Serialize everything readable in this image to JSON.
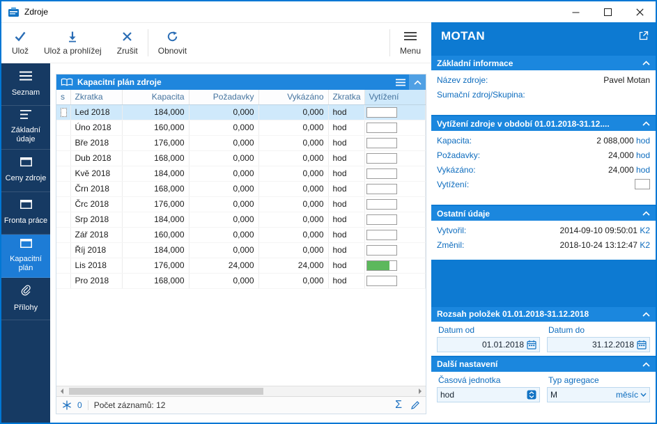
{
  "window": {
    "title": "Zdroje"
  },
  "colors": {
    "accent": "#0d7ad2",
    "sidebar": "#163a63",
    "selection": "#cfe9fb",
    "utilization_green": "#5cb85c",
    "label_blue": "#0d6cbe"
  },
  "icons": {
    "sigma": "Σ"
  },
  "toolbar": {
    "save": "Ulož",
    "save_and_view": "Ulož a prohlížej",
    "cancel": "Zrušit",
    "refresh": "Obnovit",
    "menu": "Menu"
  },
  "sidebar": {
    "items": [
      {
        "id": "seznam",
        "label": "Seznam",
        "icon": "menu",
        "selected": false
      },
      {
        "id": "zakladni-udaje",
        "label": "Základní údaje",
        "icon": "list",
        "selected": false
      },
      {
        "id": "ceny-zdroje",
        "label": "Ceny zdroje",
        "icon": "panel",
        "selected": false
      },
      {
        "id": "fronta-prace",
        "label": "Fronta práce",
        "icon": "panel",
        "selected": false
      },
      {
        "id": "kapacitni-plan",
        "label": "Kapacitní plán",
        "icon": "panel",
        "selected": true
      },
      {
        "id": "prilohy",
        "label": "Přílohy",
        "icon": "clip",
        "selected": false
      }
    ]
  },
  "grid": {
    "title": "Kapacitní plán zdroje",
    "columns": [
      "s",
      "Zkratka",
      "Kapacita",
      "Požadavky",
      "Vykázáno",
      "Zkratka",
      "Vytížení"
    ],
    "rows": [
      {
        "zkratka": "Led 2018",
        "kapacita": "184,000",
        "pozadavky": "0,000",
        "vykazano": "0,000",
        "jednotka": "hod",
        "vytizeni_pct": 0,
        "selected": true
      },
      {
        "zkratka": "Úno 2018",
        "kapacita": "160,000",
        "pozadavky": "0,000",
        "vykazano": "0,000",
        "jednotka": "hod",
        "vytizeni_pct": 0,
        "selected": false
      },
      {
        "zkratka": "Bře 2018",
        "kapacita": "176,000",
        "pozadavky": "0,000",
        "vykazano": "0,000",
        "jednotka": "hod",
        "vytizeni_pct": 0,
        "selected": false
      },
      {
        "zkratka": "Dub 2018",
        "kapacita": "168,000",
        "pozadavky": "0,000",
        "vykazano": "0,000",
        "jednotka": "hod",
        "vytizeni_pct": 0,
        "selected": false
      },
      {
        "zkratka": "Kvě 2018",
        "kapacita": "184,000",
        "pozadavky": "0,000",
        "vykazano": "0,000",
        "jednotka": "hod",
        "vytizeni_pct": 0,
        "selected": false
      },
      {
        "zkratka": "Črn 2018",
        "kapacita": "168,000",
        "pozadavky": "0,000",
        "vykazano": "0,000",
        "jednotka": "hod",
        "vytizeni_pct": 0,
        "selected": false
      },
      {
        "zkratka": "Črc 2018",
        "kapacita": "176,000",
        "pozadavky": "0,000",
        "vykazano": "0,000",
        "jednotka": "hod",
        "vytizeni_pct": 0,
        "selected": false
      },
      {
        "zkratka": "Srp 2018",
        "kapacita": "184,000",
        "pozadavky": "0,000",
        "vykazano": "0,000",
        "jednotka": "hod",
        "vytizeni_pct": 0,
        "selected": false
      },
      {
        "zkratka": "Zář 2018",
        "kapacita": "160,000",
        "pozadavky": "0,000",
        "vykazano": "0,000",
        "jednotka": "hod",
        "vytizeni_pct": 0,
        "selected": false
      },
      {
        "zkratka": "Říj 2018",
        "kapacita": "184,000",
        "pozadavky": "0,000",
        "vykazano": "0,000",
        "jednotka": "hod",
        "vytizeni_pct": 0,
        "selected": false
      },
      {
        "zkratka": "Lis 2018",
        "kapacita": "176,000",
        "pozadavky": "24,000",
        "vykazano": "24,000",
        "jednotka": "hod",
        "vytizeni_pct": 78,
        "selected": false
      },
      {
        "zkratka": "Pro 2018",
        "kapacita": "168,000",
        "pozadavky": "0,000",
        "vykazano": "0,000",
        "jednotka": "hod",
        "vytizeni_pct": 0,
        "selected": false
      }
    ],
    "status": {
      "flag_count": "0",
      "record_count_text": "Počet záznamů: 12"
    }
  },
  "detail": {
    "title": "MOTAN",
    "basic": {
      "header": "Základní informace",
      "fields": [
        {
          "label": "Název zdroje:",
          "value": "Pavel Motan"
        },
        {
          "label": "Sumační zdroj/Skupina:",
          "value": ""
        }
      ]
    },
    "utilization": {
      "header": "Vytížení zdroje v období 01.01.2018-31.12....",
      "fields": [
        {
          "label": "Kapacita:",
          "value": "2 088,000",
          "unit": "hod"
        },
        {
          "label": "Požadavky:",
          "value": "24,000",
          "unit": "hod"
        },
        {
          "label": "Vykázáno:",
          "value": "24,000",
          "unit": "hod"
        },
        {
          "label": "Vytížení:",
          "box": true
        }
      ]
    },
    "other": {
      "header": "Ostatní údaje",
      "fields": [
        {
          "label": "Vytvořil:",
          "value": "2014-09-10 09:50:01",
          "unit": "K2"
        },
        {
          "label": "Změnil:",
          "value": "2018-10-24 13:12:47",
          "unit": "K2"
        }
      ]
    },
    "range": {
      "header": "Rozsah položek 01.01.2018-31.12.2018",
      "date_from_label": "Datum od",
      "date_to_label": "Datum do",
      "date_from": "01.01.2018",
      "date_to": "31.12.2018"
    },
    "settings": {
      "header": "Další nastavení",
      "time_unit_label": "Časová jednotka",
      "time_unit": "hod",
      "aggregation_label": "Typ agregace",
      "aggregation_code": "M",
      "aggregation_text": "měsíc"
    }
  }
}
